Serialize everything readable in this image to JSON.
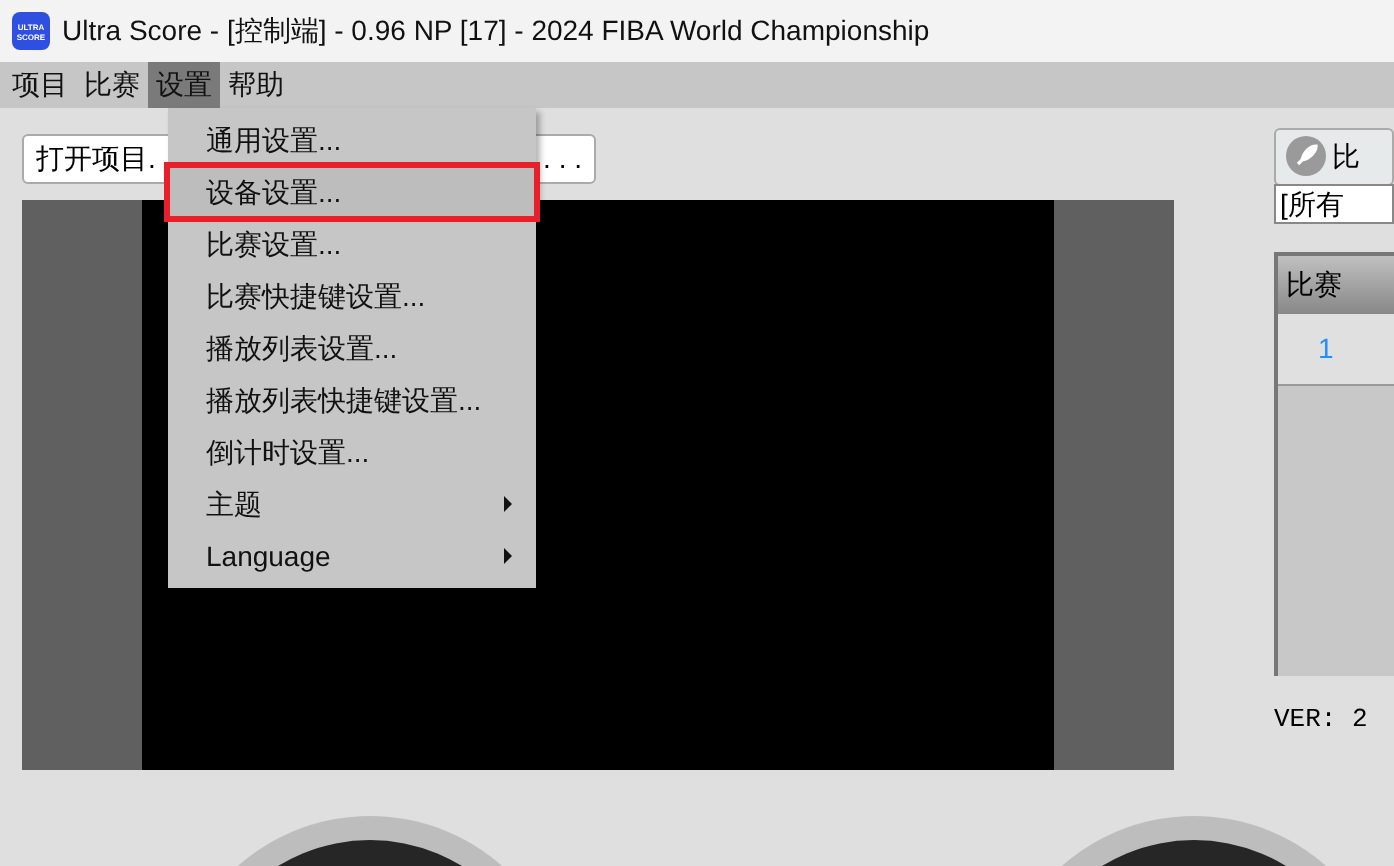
{
  "window": {
    "title": "Ultra Score - [控制端] - 0.96 NP [17] - 2024 FIBA World Championship",
    "icon_text": [
      "ULTRA",
      "SCORE"
    ]
  },
  "menu_bar": [
    {
      "label": "项目",
      "selected": false
    },
    {
      "label": "比赛",
      "selected": false
    },
    {
      "label": "设置",
      "selected": true
    },
    {
      "label": "帮助",
      "selected": false
    }
  ],
  "settings_menu": [
    {
      "label": "通用设置...",
      "selected": false,
      "submenu": false
    },
    {
      "label": "设备设置...",
      "selected": true,
      "submenu": false
    },
    {
      "label": "比赛设置...",
      "selected": false,
      "submenu": false
    },
    {
      "label": "比赛快捷键设置...",
      "selected": false,
      "submenu": false
    },
    {
      "label": "播放列表设置...",
      "selected": false,
      "submenu": false
    },
    {
      "label": "播放列表快捷键设置...",
      "selected": false,
      "submenu": false
    },
    {
      "label": "倒计时设置...",
      "selected": false,
      "submenu": false
    },
    {
      "label": "主题",
      "selected": false,
      "submenu": true
    },
    {
      "label": "Language",
      "selected": false,
      "submenu": true
    }
  ],
  "open_project": {
    "label": "打开项目.",
    "browse": ". . ."
  },
  "right_panel": {
    "button": "比",
    "filter": "[所有",
    "table": {
      "columns": [
        "比赛"
      ],
      "rows": [
        "1"
      ]
    },
    "version": "VER: 2"
  }
}
